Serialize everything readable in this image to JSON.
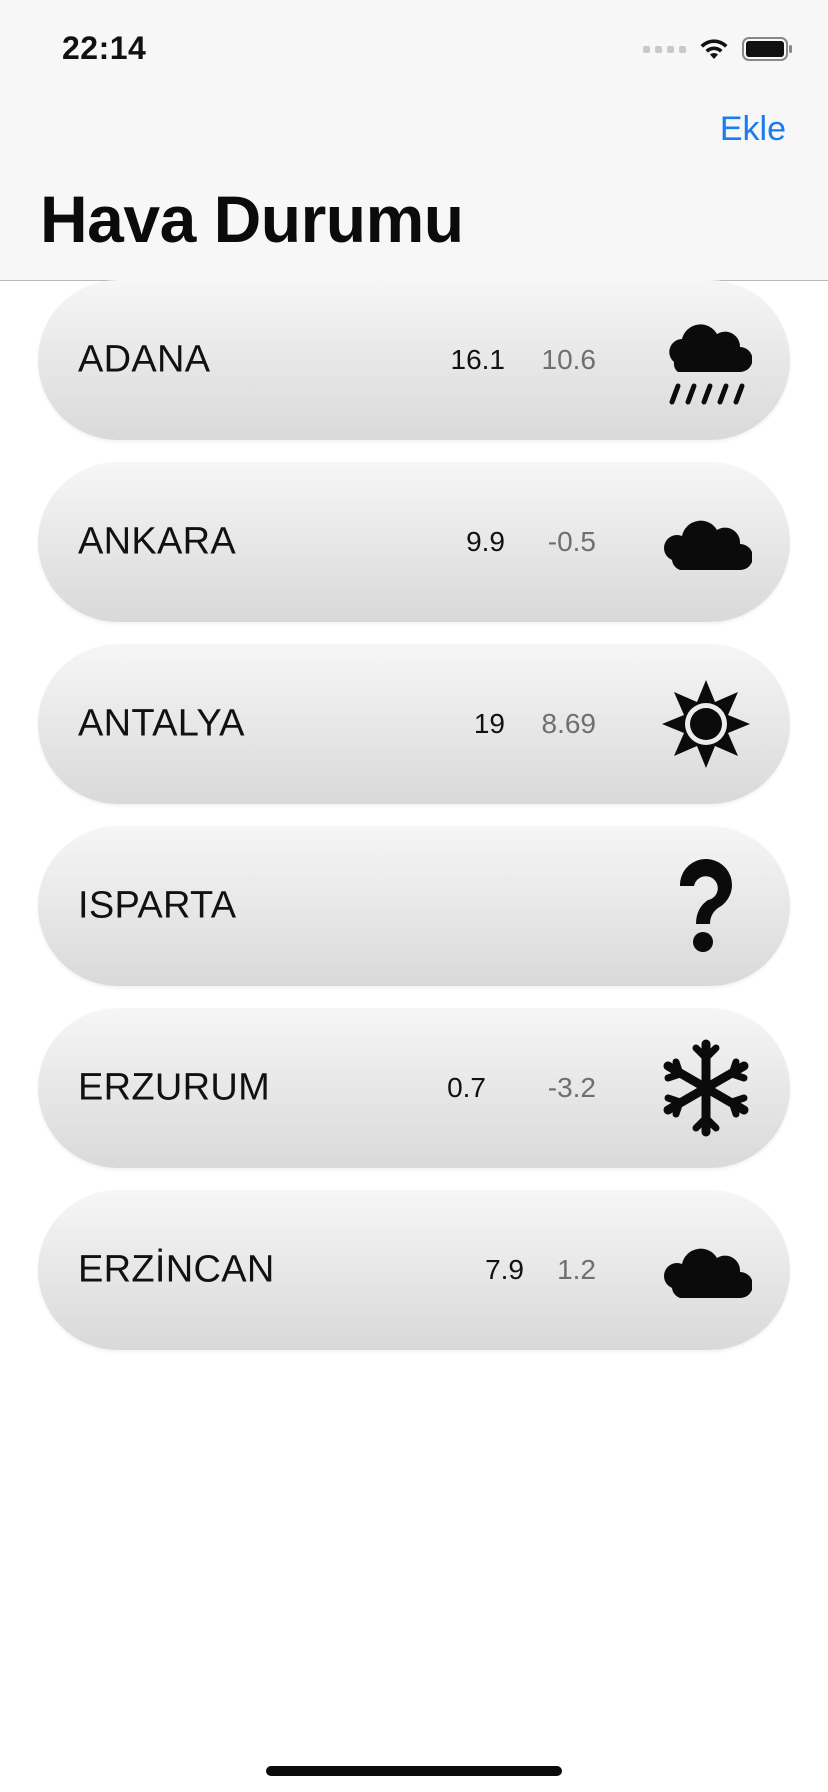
{
  "status_bar": {
    "time": "22:14"
  },
  "nav": {
    "add_button": "Ekle",
    "title": "Hava Durumu"
  },
  "cities": [
    {
      "name": "ADANA",
      "high": "16.1",
      "low": "10.6",
      "icon": "cloud-rain-icon"
    },
    {
      "name": "ANKARA",
      "high": "9.9",
      "low": "-0.5",
      "icon": "cloud-icon"
    },
    {
      "name": "ANTALYA",
      "high": "19",
      "low": "8.69",
      "icon": "sun-icon"
    },
    {
      "name": "ISPARTA",
      "high": "",
      "low": "",
      "icon": "question-icon"
    },
    {
      "name": "ERZURUM",
      "high": "0.7",
      "low": "-3.2",
      "icon": "snowflake-icon"
    },
    {
      "name": "ERZİNCAN",
      "high": "7.9",
      "low": "1.2",
      "icon": "cloud-icon"
    }
  ],
  "colors": {
    "accent": "#1a7cf0",
    "card_top": "#f6f6f6",
    "card_bottom": "#d9d9d9"
  }
}
